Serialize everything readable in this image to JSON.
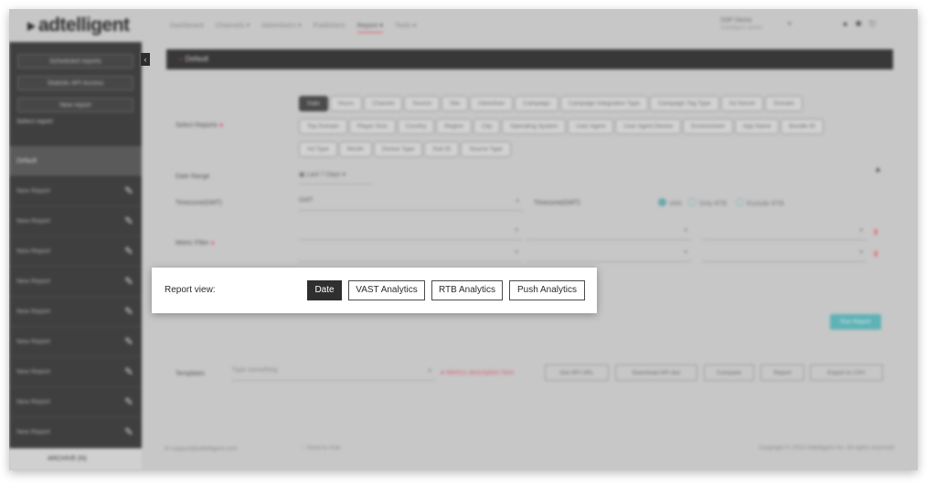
{
  "sidebar": {
    "logo": "adtelligent",
    "scheduled_reports": "Scheduled reports",
    "api_access": "Statistic API Access",
    "new_report": "New report",
    "select_report_label": "Select report",
    "items": [
      {
        "label": "Default",
        "active": true
      },
      {
        "label": "New Report"
      },
      {
        "label": "New Report"
      },
      {
        "label": "New Report"
      },
      {
        "label": "New Report"
      },
      {
        "label": "New Report"
      },
      {
        "label": "New Report"
      },
      {
        "label": "New Report"
      },
      {
        "label": "New Report"
      },
      {
        "label": "New Report"
      }
    ],
    "footer": "ARCHIVE (N)"
  },
  "topnav": {
    "items": [
      "Dashboard",
      "Channels ▾",
      "Advertisers ▾",
      "Publishers",
      "Report ▾",
      "Tools ▾"
    ],
    "user_name": "SSP Demo",
    "user_sub": "Adtelligent admin"
  },
  "title": "Default",
  "form": {
    "select_reports_label": "Select Reports",
    "chips": [
      "Date",
      "Hours",
      "Channel",
      "Source",
      "Site",
      "Advertiser",
      "Campaign",
      "Campaign Integration Type",
      "Campaign Tag Type",
      "Ad Server",
      "Domain",
      "Top Domain",
      "Player Size",
      "Country",
      "Region",
      "City",
      "Operating System",
      "User Agent",
      "User Agent Device",
      "Environment",
      "App Name",
      "Bundle ID",
      "Ad Type",
      "Month",
      "Device Type",
      "Sub ID",
      "Source Type"
    ],
    "date_range_label": "Date Range",
    "date_range_value": "Last 7 Days",
    "timezone_label": "Timezone(GMT)",
    "timezone_value": "GMT",
    "timezone_label_2": "Timezone(GMT)",
    "radios": [
      {
        "label": "VAR",
        "on": true
      },
      {
        "label": "Only RTB"
      },
      {
        "label": "Exclude RTB"
      }
    ],
    "metric_filter_label": "Metric Filter",
    "run_report": "Run Report",
    "templates_label": "Templates",
    "templates_placeholder": "Type something",
    "templates_link": "Metrics description here",
    "actions": [
      "Get API URL",
      "Download API doc",
      "Compare",
      "Report",
      "Export to CSV"
    ]
  },
  "footer": {
    "email": "support@adtelligent.com",
    "chat": "Send to chat",
    "copyright": "Copyright © 2023 Adtelligent Inc. All rights reserved"
  },
  "popup": {
    "label": "Report view:",
    "buttons": [
      {
        "label": "Date",
        "active": true
      },
      {
        "label": "VAST Analytics"
      },
      {
        "label": "RTB Analytics"
      },
      {
        "label": "Push Analytics"
      }
    ]
  }
}
